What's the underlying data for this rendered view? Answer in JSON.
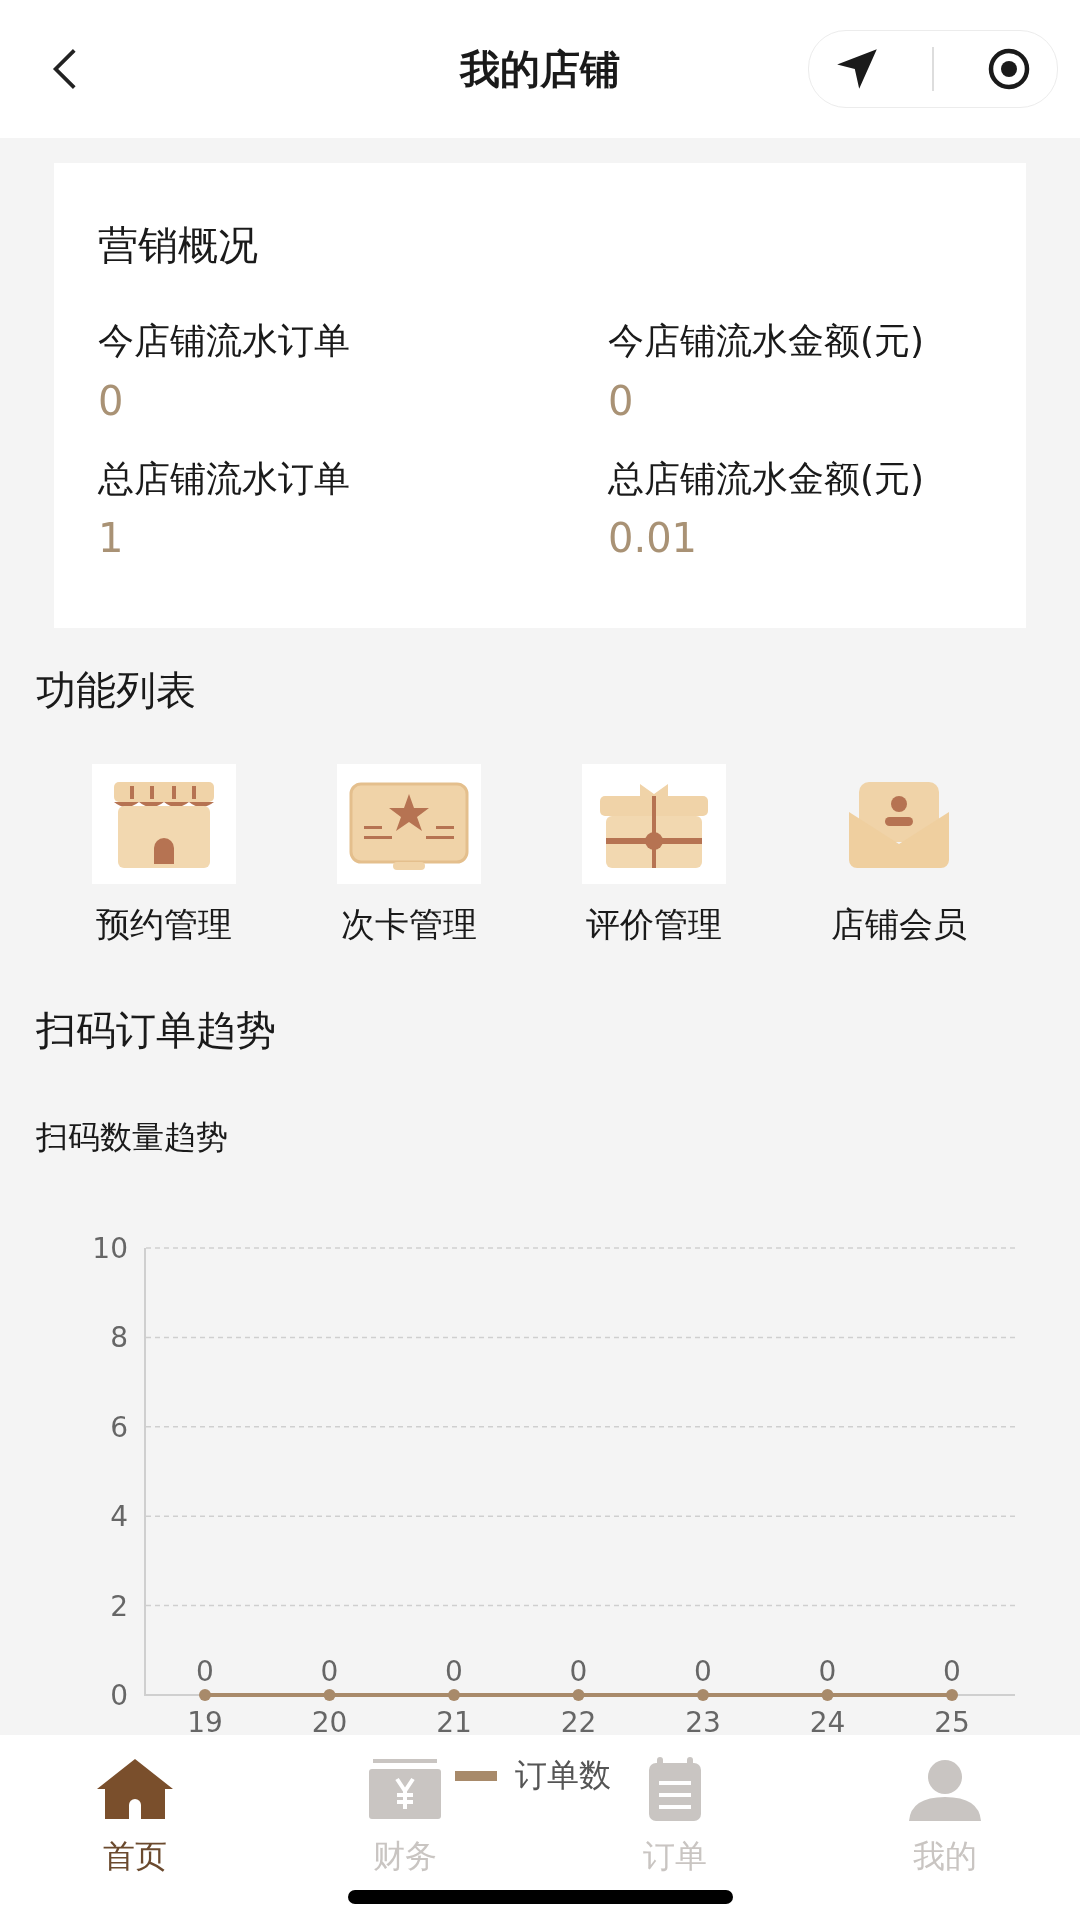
{
  "header": {
    "title": "我的店铺"
  },
  "overview": {
    "title": "营销概况",
    "stats": [
      {
        "label": "今店铺流水订单",
        "value": "0"
      },
      {
        "label": "今店铺流水金额(元)",
        "value": "0"
      },
      {
        "label": "总店铺流水订单",
        "value": "1"
      },
      {
        "label": "总店铺流水金额(元)",
        "value": "0.01"
      }
    ]
  },
  "functions": {
    "title": "功能列表",
    "items": [
      {
        "label": "预约管理",
        "kind": "shop"
      },
      {
        "label": "次卡管理",
        "kind": "card"
      },
      {
        "label": "评价管理",
        "kind": "gift"
      },
      {
        "label": "店铺会员",
        "kind": "member"
      }
    ]
  },
  "trend": {
    "title": "扫码订单趋势",
    "chart_data": {
      "type": "line",
      "title": "扫码数量趋势",
      "categories": [
        "19",
        "20",
        "21",
        "22",
        "23",
        "24",
        "25"
      ],
      "series": [
        {
          "name": "订单数",
          "color": "#a88a6a",
          "marker": true,
          "values": [
            0,
            0,
            0,
            0,
            0,
            0,
            0
          ]
        }
      ],
      "ylim": [
        0,
        10
      ],
      "yticks": [
        0,
        2,
        4,
        6,
        8,
        10
      ],
      "grid": true,
      "data_labels": true
    }
  },
  "tabbar": [
    {
      "label": "首页",
      "kind": "home",
      "selected": true
    },
    {
      "label": "财务",
      "kind": "finance",
      "selected": false
    },
    {
      "label": "订单",
      "kind": "orders",
      "selected": false
    },
    {
      "label": "我的",
      "kind": "me",
      "selected": false
    }
  ]
}
